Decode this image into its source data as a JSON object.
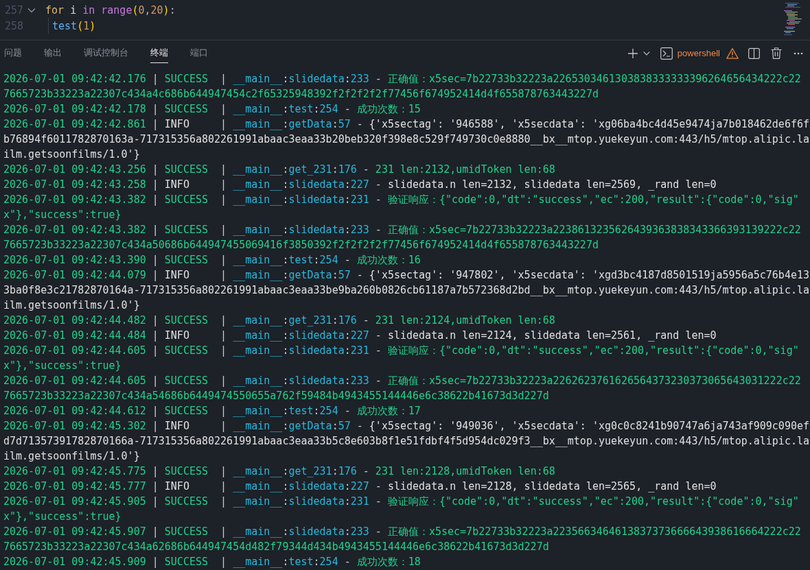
{
  "editor": {
    "lines": [
      {
        "number": "257",
        "expanded": true,
        "tokens": [
          {
            "text": "for ",
            "kind": "keyword"
          },
          {
            "text": "i ",
            "kind": "variable"
          },
          {
            "text": "in ",
            "kind": "operator"
          },
          {
            "text": "range",
            "kind": "builtin"
          },
          {
            "text": "(",
            "kind": "bracket"
          },
          {
            "text": "0",
            "kind": "number"
          },
          {
            "text": ",",
            "kind": "punct"
          },
          {
            "text": "20",
            "kind": "number"
          },
          {
            "text": ")",
            "kind": "bracket"
          },
          {
            "text": ":",
            "kind": "punct"
          }
        ],
        "children": [
          {
            "number": "258",
            "tokens": [
              {
                "text": "test",
                "kind": "function"
              },
              {
                "text": "(",
                "kind": "bracket"
              },
              {
                "text": "1",
                "kind": "number"
              },
              {
                "text": ")",
                "kind": "bracket"
              }
            ]
          }
        ]
      }
    ]
  },
  "panel": {
    "tabs": [
      {
        "label": "问题",
        "selected": false
      },
      {
        "label": "输出",
        "selected": false
      },
      {
        "label": "调试控制台",
        "selected": false
      },
      {
        "label": "终端",
        "selected": true
      },
      {
        "label": "端口",
        "selected": false
      }
    ],
    "terminal_profile": {
      "label": "powershell",
      "warning": true
    }
  },
  "terminal": {
    "entries": [
      {
        "kind": "success",
        "time": "2026-07-01 09:42:42.176",
        "level": "SUCCESS",
        "separators": [
          "|",
          "|",
          ":",
          ":",
          "-"
        ],
        "name": "__main__",
        "function": "slidedata",
        "line": "233",
        "message": [
          "正确值：x5sec=7b22733b32223a2265303461303838333333396264656434222c22",
          "7665723b33223a22307c434a4c686b644947454c2f65325948392f2f2f2f2f77456f674952414d4f655878763443227d"
        ]
      },
      {
        "kind": "success",
        "time": "2026-07-01 09:42:42.178",
        "level": "SUCCESS",
        "separators": [
          "|",
          "|",
          ":",
          ":",
          "-"
        ],
        "name": "__main__",
        "function": "test",
        "line": "254",
        "message": [
          "成功次数：15"
        ]
      },
      {
        "kind": "info",
        "time": "2026-07-01 09:42:42.861",
        "level": "INFO",
        "separators": [
          "|",
          "|",
          ":",
          ":",
          "-"
        ],
        "name": "__main__",
        "function": "getData",
        "line": "57",
        "message": [
          "{'x5sectag': '946588', 'x5secdata': 'xg06ba4bc4d45e9474ja7b018462de6f6f",
          "b76894f6011782870163a-717315356a802261991abaac3eaa33b20beb320f398e8c529f749730c0e8880__bx__mtop.yuekeyun.com:443/h5/mtop.alipic.la",
          "ilm.getsoonfilms/1.0'}"
        ]
      },
      {
        "kind": "success",
        "time": "2026-07-01 09:42:43.256",
        "level": "SUCCESS",
        "separators": [
          "|",
          "|",
          ":",
          ":",
          "-"
        ],
        "name": "__main__",
        "function": "get_231",
        "line": "176",
        "message": [
          "231 len:2132,umidToken len:68"
        ]
      },
      {
        "kind": "info",
        "time": "2026-07-01 09:42:43.258",
        "level": "INFO",
        "separators": [
          "|",
          "|",
          ":",
          ":",
          "-"
        ],
        "name": "__main__",
        "function": "slidedata",
        "line": "227",
        "message": [
          "slidedata.n len=2132, slidedata len=2569, _rand len=0"
        ]
      },
      {
        "kind": "success",
        "time": "2026-07-01 09:42:43.382",
        "level": "SUCCESS",
        "separators": [
          "|",
          "|",
          ":",
          ":",
          "-"
        ],
        "name": "__main__",
        "function": "slidedata",
        "line": "231",
        "message": [
          "验证响应：{\"code\":0,\"dt\":\"success\",\"ec\":200,\"result\":{\"code\":0,\"sig\"",
          "x\"},\"success\":true}"
        ]
      },
      {
        "kind": "success",
        "time": "2026-07-01 09:42:43.382",
        "level": "SUCCESS",
        "separators": [
          "|",
          "|",
          ":",
          ":",
          "-"
        ],
        "name": "__main__",
        "function": "slidedata",
        "line": "233",
        "message": [
          "正确值：x5sec=7b22733b32223a2238613235626439363838343366393139222c22",
          "7665723b33223a22307c434a50686b644947455069416f3850392f2f2f2f2f77456f674952414d4f655878763443227d"
        ]
      },
      {
        "kind": "success",
        "time": "2026-07-01 09:42:43.390",
        "level": "SUCCESS",
        "separators": [
          "|",
          "|",
          ":",
          ":",
          "-"
        ],
        "name": "__main__",
        "function": "test",
        "line": "254",
        "message": [
          "成功次数：16"
        ]
      },
      {
        "kind": "info",
        "time": "2026-07-01 09:42:44.079",
        "level": "INFO",
        "separators": [
          "|",
          "|",
          ":",
          ":",
          "-"
        ],
        "name": "__main__",
        "function": "getData",
        "line": "57",
        "message": [
          "{'x5sectag': '947802', 'x5secdata': 'xgd3bc4187d8501519ja5956a5c76b4e13",
          "3ba0f8e3c21782870164a-717315356a802261991abaac3eaa33be9ba260b0826cb61187a7b572368d2bd__bx__mtop.yuekeyun.com:443/h5/mtop.alipic.la",
          "ilm.getsoonfilms/1.0'}"
        ]
      },
      {
        "kind": "success",
        "time": "2026-07-01 09:42:44.482",
        "level": "SUCCESS",
        "separators": [
          "|",
          "|",
          ":",
          ":",
          "-"
        ],
        "name": "__main__",
        "function": "get_231",
        "line": "176",
        "message": [
          "231 len:2124,umidToken len:68"
        ]
      },
      {
        "kind": "info",
        "time": "2026-07-01 09:42:44.484",
        "level": "INFO",
        "separators": [
          "|",
          "|",
          ":",
          ":",
          "-"
        ],
        "name": "__main__",
        "function": "slidedata",
        "line": "227",
        "message": [
          "slidedata.n len=2124, slidedata len=2561, _rand len=0"
        ]
      },
      {
        "kind": "success",
        "time": "2026-07-01 09:42:44.605",
        "level": "SUCCESS",
        "separators": [
          "|",
          "|",
          ":",
          ":",
          "-"
        ],
        "name": "__main__",
        "function": "slidedata",
        "line": "231",
        "message": [
          "验证响应：{\"code\":0,\"dt\":\"success\",\"ec\":200,\"result\":{\"code\":0,\"sig\"",
          "x\"},\"success\":true}"
        ]
      },
      {
        "kind": "success",
        "time": "2026-07-01 09:42:44.605",
        "level": "SUCCESS",
        "separators": [
          "|",
          "|",
          ":",
          ":",
          "-"
        ],
        "name": "__main__",
        "function": "slidedata",
        "line": "233",
        "message": [
          "正确值：x5sec=7b22733b32223a2262623761626564373230373065643031222c22",
          "7665723b33223a22307c434a54686b6449474550655a762f59484b4943455144446e6c38622b41673d3d227d"
        ]
      },
      {
        "kind": "success",
        "time": "2026-07-01 09:42:44.612",
        "level": "SUCCESS",
        "separators": [
          "|",
          "|",
          ":",
          ":",
          "-"
        ],
        "name": "__main__",
        "function": "test",
        "line": "254",
        "message": [
          "成功次数：17"
        ]
      },
      {
        "kind": "info",
        "time": "2026-07-01 09:42:45.302",
        "level": "INFO",
        "separators": [
          "|",
          "|",
          ":",
          ":",
          "-"
        ],
        "name": "__main__",
        "function": "getData",
        "line": "57",
        "message": [
          "{'x5sectag': '949036', 'x5secdata': 'xg0c0c8241b90747a6ja743af909c090ef",
          "d7d71357391782870166a-717315356a802261991abaac3eaa33b5c8e603b8f1e51fdbf4f5d954dc029f3__bx__mtop.yuekeyun.com:443/h5/mtop.alipic.la",
          "ilm.getsoonfilms/1.0'}"
        ]
      },
      {
        "kind": "success",
        "time": "2026-07-01 09:42:45.775",
        "level": "SUCCESS",
        "separators": [
          "|",
          "|",
          ":",
          ":",
          "-"
        ],
        "name": "__main__",
        "function": "get_231",
        "line": "176",
        "message": [
          "231 len:2128,umidToken len:68"
        ]
      },
      {
        "kind": "info",
        "time": "2026-07-01 09:42:45.777",
        "level": "INFO",
        "separators": [
          "|",
          "|",
          ":",
          ":",
          "-"
        ],
        "name": "__main__",
        "function": "slidedata",
        "line": "227",
        "message": [
          "slidedata.n len=2128, slidedata len=2565, _rand len=0"
        ]
      },
      {
        "kind": "success",
        "time": "2026-07-01 09:42:45.905",
        "level": "SUCCESS",
        "separators": [
          "|",
          "|",
          ":",
          ":",
          "-"
        ],
        "name": "__main__",
        "function": "slidedata",
        "line": "231",
        "message": [
          "验证响应：{\"code\":0,\"dt\":\"success\",\"ec\":200,\"result\":{\"code\":0,\"sig\"",
          "x\"},\"success\":true}"
        ]
      },
      {
        "kind": "success",
        "time": "2026-07-01 09:42:45.907",
        "level": "SUCCESS",
        "separators": [
          "|",
          "|",
          ":",
          ":",
          "-"
        ],
        "name": "__main__",
        "function": "slidedata",
        "line": "233",
        "message": [
          "正确值：x5sec=7b22733b32223a2235663464613837373666643938616664222c22",
          "7665723b33223a22307c434a62686b644947454d482f79344d434b4943455144446e6c38622b41673d3d227d"
        ]
      },
      {
        "kind": "success",
        "time": "2026-07-01 09:42:45.909",
        "level": "SUCCESS",
        "separators": [
          "|",
          "|",
          ":",
          ":",
          "-"
        ],
        "name": "__main__",
        "function": "test",
        "line": "254",
        "message": [
          "成功次数：18"
        ]
      }
    ]
  }
}
